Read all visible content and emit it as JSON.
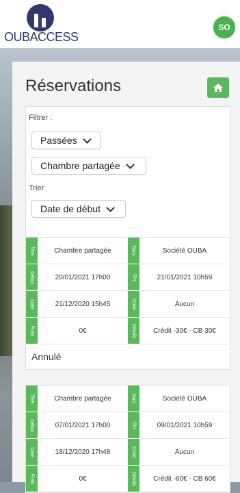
{
  "brand": {
    "logo_text": "OUBACCESS"
  },
  "user": {
    "initials": "SO"
  },
  "page": {
    "title": "Réservations"
  },
  "filters": {
    "filter_label": "Filtrer :",
    "period_value": "Passées",
    "room_value": "Chambre partagée",
    "sort_label": "Trier",
    "sort_value": "Date de début"
  },
  "labels": {
    "type": "Titre",
    "person": "Pers.",
    "start": "Début",
    "end": "Fin",
    "date": "Date",
    "code": "Code",
    "fees": "Frais",
    "details": "Détails"
  },
  "reservations": [
    {
      "type": "Chambre partagée",
      "person": "Société OUBA",
      "start": "20/01/2021 17h00",
      "end": "21/01/2021 10h59",
      "date": "21/12/2020 15h45",
      "code": "Aucun",
      "fees": "0€",
      "details": "Crédit -30€ - CB 30€",
      "status": "Annulé"
    },
    {
      "type": "Chambre partagée",
      "person": "Société OUBA",
      "start": "07/01/2021 17h00",
      "end": "09/01/2021 10h59",
      "date": "18/12/2020 17h48",
      "code": "Aucun",
      "fees": "0€",
      "details": "Crédit -60€ - CB 60€"
    }
  ],
  "colors": {
    "accent": "#5cb85c",
    "brand": "#2e3a6e"
  }
}
